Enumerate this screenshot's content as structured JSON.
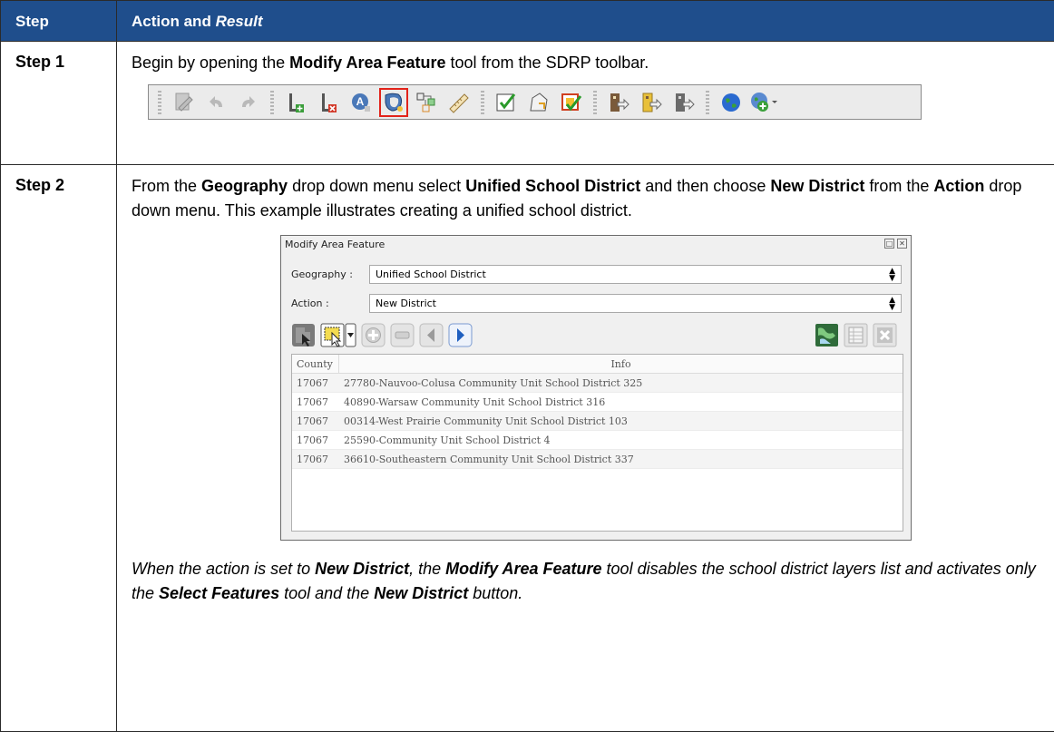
{
  "header": {
    "step": "Step",
    "action_plain": "Action and ",
    "action_italic": "Result"
  },
  "step1": {
    "label": "Step 1",
    "t1": "Begin by opening the ",
    "b1": "Modify Area Feature",
    "t2": " tool from the SDRP toolbar.",
    "toolbar_icons": [
      "edit-icon",
      "undo-icon",
      "redo-icon",
      "add-layer-icon",
      "remove-layer-icon",
      "address-icon",
      "modify-area-feature-icon",
      "topology-icon",
      "measure-icon",
      "validate-icon",
      "shape-icon",
      "review-icon",
      "export-icon",
      "export-yellow-icon",
      "export-gray-icon",
      "globe-icon",
      "add-globe-icon"
    ]
  },
  "step2": {
    "label": "Step 2",
    "t1": "From the ",
    "b1": "Geography",
    "t2": " drop down menu select ",
    "b2": "Unified School District",
    "t3": " and then choose ",
    "b3": "New District",
    "t4": " from the ",
    "b4": "Action",
    "t5": " drop down menu. This example illustrates creating a unified school district.",
    "dialog": {
      "title": "Modify Area Feature",
      "geography_label": "Geography :",
      "geography_value": "Unified School District",
      "action_label": "Action :",
      "action_value": "New District",
      "col_county": "County",
      "col_info": "Info",
      "rows": [
        {
          "county": "17067",
          "info": "27780-Nauvoo-Colusa Community Unit School District 325"
        },
        {
          "county": "17067",
          "info": "40890-Warsaw Community Unit School District 316"
        },
        {
          "county": "17067",
          "info": "00314-West Prairie Community Unit School District 103"
        },
        {
          "county": "17067",
          "info": "25590-Community Unit School District 4"
        },
        {
          "county": "17067",
          "info": "36610-Southeastern Community Unit School District 337"
        }
      ]
    },
    "note": {
      "t1": "When the action is set to ",
      "b1": "New District",
      "t2": ", the ",
      "b2": "Modify Area Feature",
      "t3": " tool disables the school district layers list and activates only the ",
      "b3": "Select Features",
      "t4": " tool and the ",
      "b4": "New District",
      "t5": " button."
    }
  },
  "colors": {
    "header_bg": "#1f4e8c",
    "highlight": "#e2231a"
  }
}
